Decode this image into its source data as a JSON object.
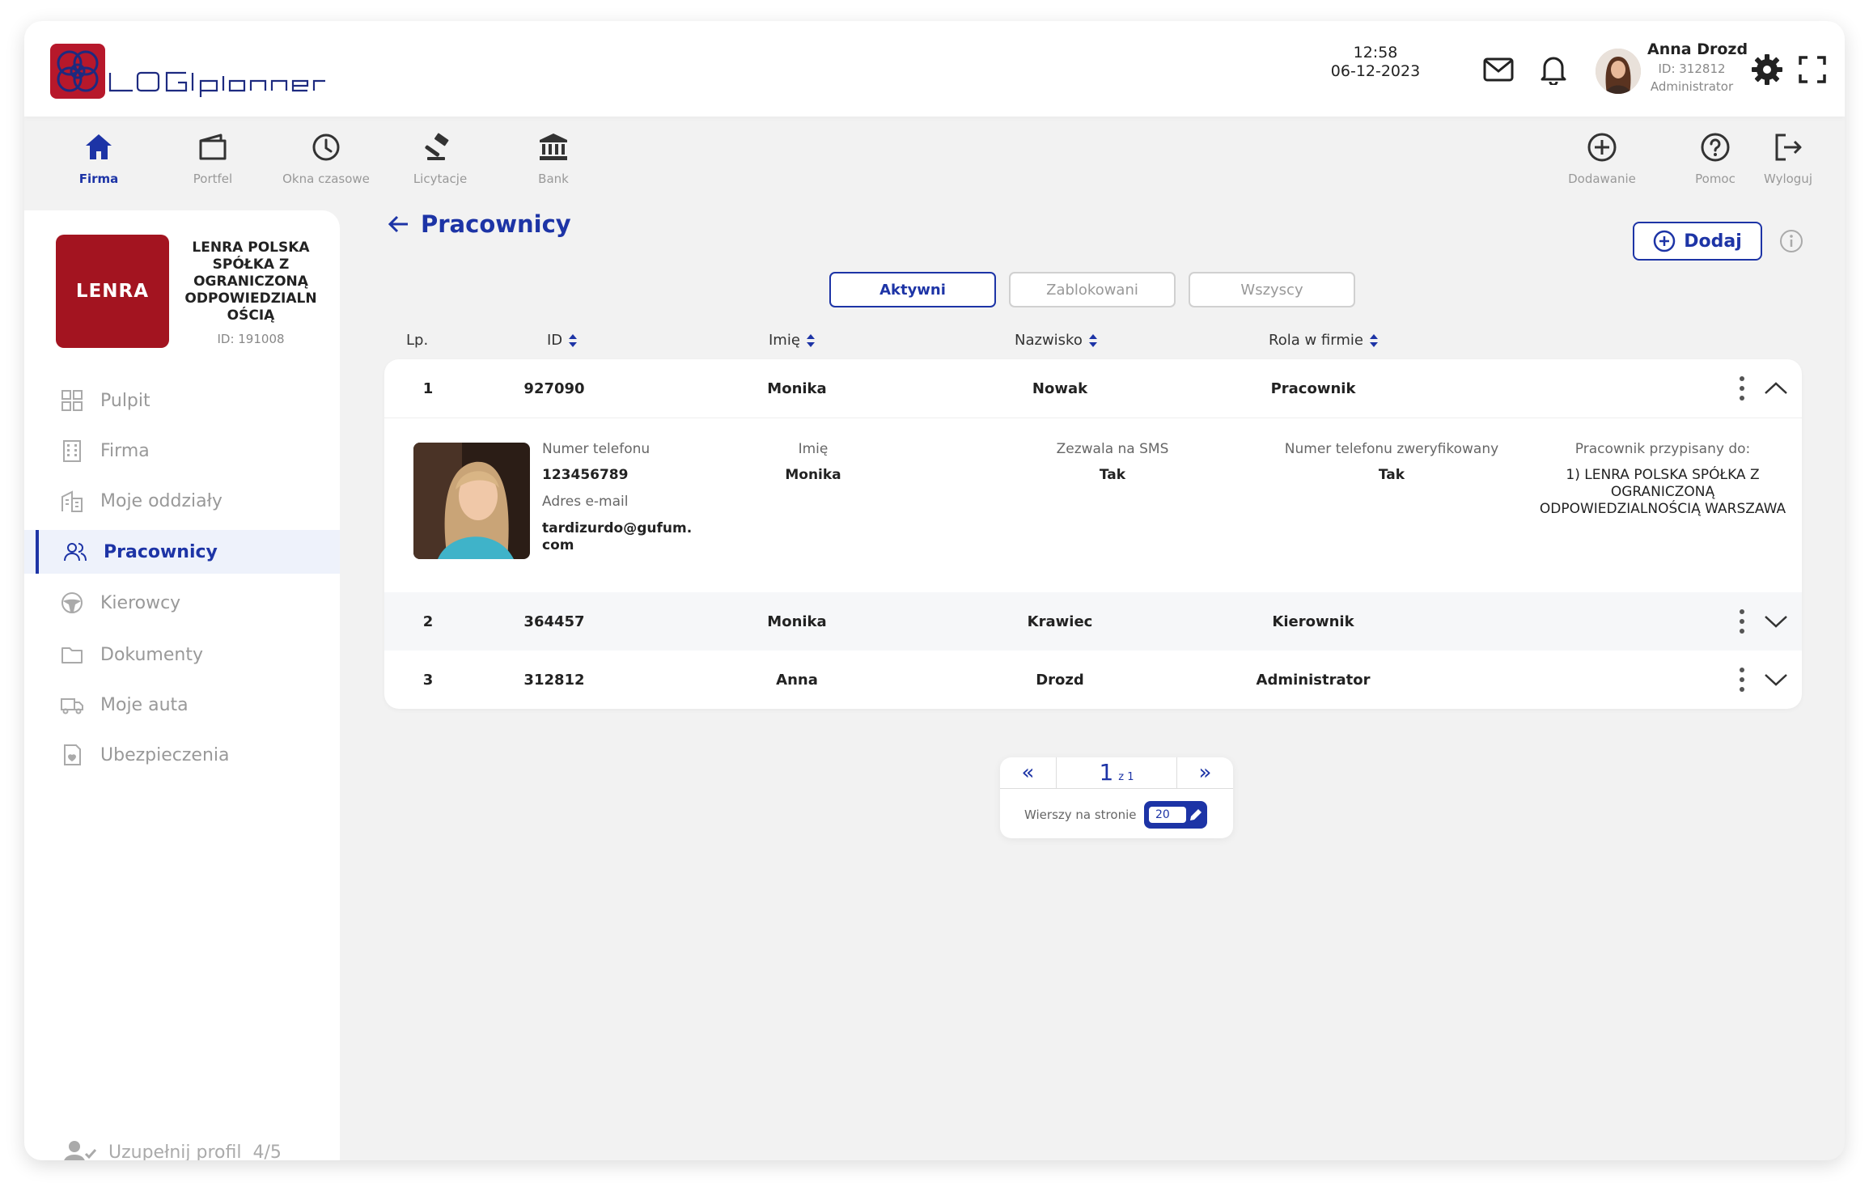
{
  "header": {
    "time": "12:58",
    "date": "06-12-2023",
    "user": {
      "name": "Anna Drozd",
      "id": "ID: 312812",
      "role": "Administrator"
    }
  },
  "nav": {
    "left": [
      {
        "label": "Firma",
        "icon": "home-icon",
        "active": true
      },
      {
        "label": "Portfel",
        "icon": "wallet-icon"
      },
      {
        "label": "Okna czasowe",
        "icon": "clock-icon"
      },
      {
        "label": "Licytacje",
        "icon": "gavel-icon"
      },
      {
        "label": "Bank",
        "icon": "bank-icon"
      }
    ],
    "right": [
      {
        "label": "Dodawanie",
        "icon": "plus-circle-icon"
      },
      {
        "label": "Pomoc",
        "icon": "help-icon"
      },
      {
        "label": "Wyloguj",
        "icon": "logout-icon"
      }
    ]
  },
  "company": {
    "logo_text": "LENRA",
    "name": "LENRA POLSKA SPÓŁKA Z OGRANICZONĄ ODPOWIEDZIALN OŚCIĄ",
    "id": "ID: 191008"
  },
  "sidebar": {
    "items": [
      {
        "label": "Pulpit",
        "icon": "grid-icon"
      },
      {
        "label": "Firma",
        "icon": "building-icon"
      },
      {
        "label": "Moje oddziały",
        "icon": "branches-icon"
      },
      {
        "label": "Pracownicy",
        "icon": "users-icon",
        "active": true
      },
      {
        "label": "Kierowcy",
        "icon": "steering-wheel-icon"
      },
      {
        "label": "Dokumenty",
        "icon": "folder-icon"
      },
      {
        "label": "Moje auta",
        "icon": "truck-icon"
      },
      {
        "label": "Ubezpieczenia",
        "icon": "insurance-icon"
      }
    ],
    "complete_profile": "Uzupełnij profil",
    "complete_progress": "4/5"
  },
  "page": {
    "title": "Pracownicy",
    "add_label": "Dodaj",
    "filters": [
      {
        "label": "Aktywni",
        "active": true
      },
      {
        "label": "Zablokowani"
      },
      {
        "label": "Wszyscy"
      }
    ]
  },
  "table": {
    "columns": [
      "Lp.",
      "ID",
      "Imię",
      "Nazwisko",
      "Rola w firmie"
    ],
    "rows": [
      {
        "lp": "1",
        "id": "927090",
        "first": "Monika",
        "last": "Nowak",
        "role": "Pracownik",
        "expanded": true
      },
      {
        "lp": "2",
        "id": "364457",
        "first": "Monika",
        "last": "Krawiec",
        "role": "Kierownik"
      },
      {
        "lp": "3",
        "id": "312812",
        "first": "Anna",
        "last": "Drozd",
        "role": "Administrator"
      }
    ],
    "detail": {
      "phone_label": "Numer telefonu",
      "phone": "123456789",
      "email_label": "Adres e-mail",
      "email_line1": "tardizurdo@gufum.",
      "email_line2": "com",
      "first_label": "Imię",
      "first": "Monika",
      "sms_label": "Zezwala na SMS",
      "sms": "Tak",
      "verified_label": "Numer telefonu zweryfikowany",
      "verified": "Tak",
      "assigned_label": "Pracownik przypisany do:",
      "assigned": "1) LENRA POLSKA SPÓŁKA Z OGRANICZONĄ ODPOWIEDZIALNOŚCIĄ WARSZAWA"
    }
  },
  "pagination": {
    "prev": "«",
    "next": "»",
    "current": "1",
    "of": "z 1",
    "rows_label": "Wierszy na stronie",
    "rows_value": "20"
  },
  "colors": {
    "accent": "#1d34a6",
    "brand_red": "#a31420"
  }
}
